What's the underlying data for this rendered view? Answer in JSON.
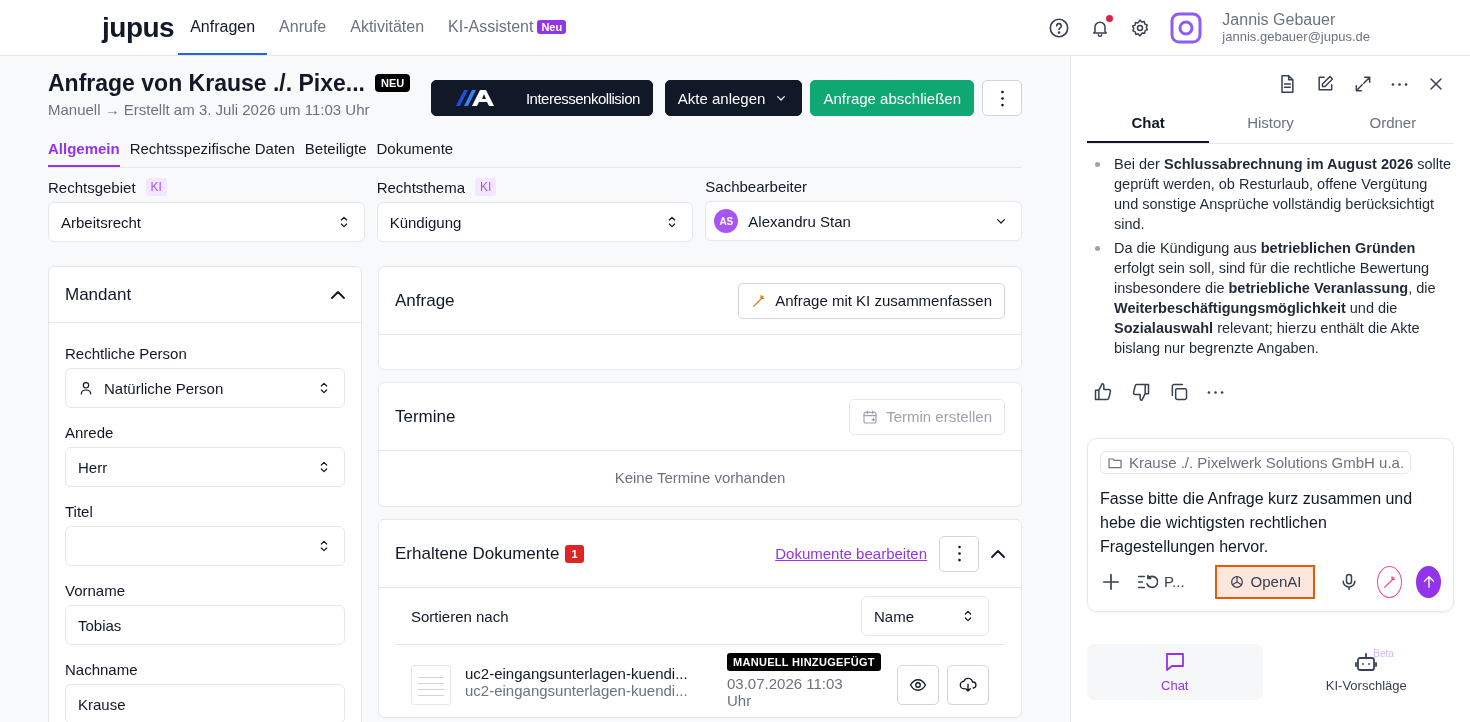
{
  "nav": {
    "logo": "jupus",
    "items": [
      {
        "label": "Anfragen",
        "selected": true
      },
      {
        "label": "Anrufe",
        "selected": false
      },
      {
        "label": "Aktivitäten",
        "selected": false
      },
      {
        "label": "KI-Assistent",
        "selected": false,
        "badge": "Neu"
      }
    ]
  },
  "user": {
    "name": "Jannis Gebauer",
    "email": "jannis.gebauer@jupus.de",
    "notification": true
  },
  "header": {
    "title": "Anfrage von Krause ./. Pixe...",
    "badge": "NEU",
    "subtitle": "Manuell → Erstellt am 3. Juli 2026 um 11:03 Uhr",
    "buttons": [
      {
        "kind": "logo",
        "label": "Interessenkollision"
      },
      {
        "kind": "dropdown",
        "label": "Akte anlegen"
      },
      {
        "kind": "primary",
        "label": "Anfrage abschließen"
      },
      {
        "kind": "more"
      }
    ]
  },
  "tabs": [
    {
      "label": "Allgemein",
      "selected": true
    },
    {
      "label": "Rechtsspezifische Daten",
      "selected": false
    },
    {
      "label": "Beteiligte",
      "selected": false
    },
    {
      "label": "Dokumente",
      "selected": false
    }
  ],
  "fields": [
    {
      "kind": "select",
      "label": "Rechtsgebiet",
      "tag": "KI",
      "value": "Arbeitsrecht"
    },
    {
      "kind": "select",
      "label": "Rechtsthema",
      "tag": "KI",
      "value": "Kündigung"
    },
    {
      "kind": "person",
      "label": "Sachbearbeiter",
      "avatar": "AS",
      "value": "Alexandru Stan"
    }
  ],
  "mandant": {
    "title": "Mandant",
    "expanded": true,
    "fields": [
      {
        "kind": "person-select",
        "label": "Rechtliche Person",
        "value": "Natürliche Person"
      },
      {
        "kind": "select",
        "label": "Anrede",
        "value": "Herr"
      },
      {
        "kind": "select",
        "label": "Titel"
      },
      {
        "kind": "text",
        "label": "Vorname",
        "value": "Tobias"
      },
      {
        "kind": "text",
        "label": "Nachname",
        "value": "Krause"
      }
    ]
  },
  "anfrage": {
    "title": "Anfrage",
    "button": "Anfrage mit KI zusammenfassen"
  },
  "termine": {
    "title": "Termine",
    "button": "Termin erstellen",
    "button_disabled": true,
    "empty": "Keine Termine vorhanden"
  },
  "documents": {
    "title": "Erhaltene Dokumente",
    "count": "1",
    "link": "Dokumente bearbeiten",
    "expanded": true,
    "sort_label": "Sortieren nach",
    "sort_value": "Name",
    "items": [
      {
        "name": "uc2-eingangsunterlagen-kuendi...",
        "filename": "uc2-eingangsunterlagen-kuendi...",
        "tag": "MANUELL HINZUGEFÜGT",
        "date": "03.07.2026 11:03 Uhr"
      }
    ]
  },
  "chat": {
    "tabs": [
      {
        "label": "Chat",
        "selected": true
      },
      {
        "label": "History",
        "selected": false
      },
      {
        "label": "Ordner",
        "selected": false
      }
    ],
    "bullets": [
      "Bei der **Schlussabrechnung im August 2026** sollte geprüft werden, ob Resturlaub, offene Vergütung und sonstige Ansprüche vollständig berücksichtigt sind.",
      "Da die Kündigung aus **betrieblichen Gründen** erfolgt sein soll, sind für die rechtliche Bewertung insbesondere die **betriebliche Veranlassung**, die **Weiterbeschäftigungsmöglichkeit** und die **Sozialauswahl** relevant; hierzu enthält die Akte bislang nur begrenzte Angaben."
    ],
    "composer": {
      "context": "Krause ./. Pixelwerk Solutions GmbH u.a.",
      "value": "Fasse bitte die Anfrage kurz zusammen und hebe die wichtigsten rechtlichen Fragestellungen hervor.",
      "prompt_label": "P...",
      "model": "OpenAI",
      "model_highlighted": true
    },
    "bottom_nav": [
      {
        "label": "Chat",
        "selected": true
      },
      {
        "label": "KI-Vorschläge",
        "selected": false,
        "badge": "Beta"
      }
    ]
  }
}
